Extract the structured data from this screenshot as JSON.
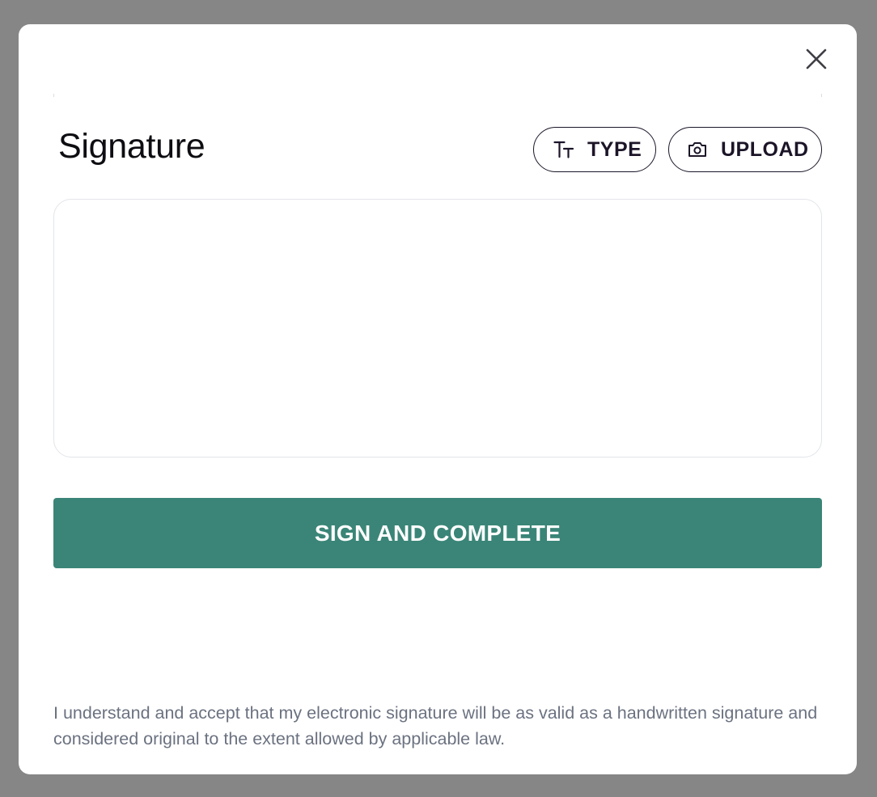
{
  "modal": {
    "title": "Signature",
    "close_icon": "close-icon",
    "type_button": {
      "label": "TYPE",
      "icon": "text-size-icon"
    },
    "upload_button": {
      "label": "UPLOAD",
      "icon": "camera-icon"
    },
    "signature_pad": {
      "value": ""
    },
    "sign_button_label": "SIGN AND COMPLETE",
    "disclaimer": "I understand and accept that my electronic signature will be as valid as a handwritten signature and considered original to the extent allowed by applicable law."
  },
  "colors": {
    "backdrop": "#868686",
    "accent": "#3a8577",
    "pill_border": "#1c1528",
    "muted_text": "#6b7280"
  }
}
